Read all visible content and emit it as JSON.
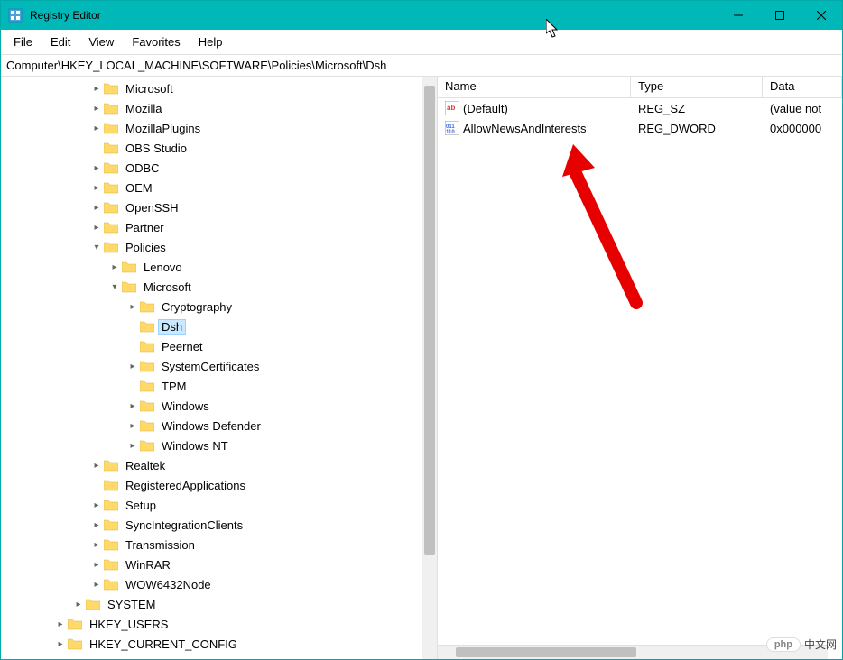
{
  "window": {
    "title": "Registry Editor"
  },
  "menu": {
    "items": [
      "File",
      "Edit",
      "View",
      "Favorites",
      "Help"
    ]
  },
  "address": "Computer\\HKEY_LOCAL_MACHINE\\SOFTWARE\\Policies\\Microsoft\\Dsh",
  "tree": [
    {
      "depth": 2,
      "chev": ">",
      "label": "Microsoft"
    },
    {
      "depth": 2,
      "chev": ">",
      "label": "Mozilla"
    },
    {
      "depth": 2,
      "chev": ">",
      "label": "MozillaPlugins"
    },
    {
      "depth": 2,
      "chev": "",
      "label": "OBS Studio"
    },
    {
      "depth": 2,
      "chev": ">",
      "label": "ODBC"
    },
    {
      "depth": 2,
      "chev": ">",
      "label": "OEM"
    },
    {
      "depth": 2,
      "chev": ">",
      "label": "OpenSSH"
    },
    {
      "depth": 2,
      "chev": ">",
      "label": "Partner"
    },
    {
      "depth": 2,
      "chev": "v",
      "label": "Policies"
    },
    {
      "depth": 3,
      "chev": ">",
      "label": "Lenovo"
    },
    {
      "depth": 3,
      "chev": "v",
      "label": "Microsoft"
    },
    {
      "depth": 4,
      "chev": ">",
      "label": "Cryptography"
    },
    {
      "depth": 4,
      "chev": "",
      "label": "Dsh",
      "selected": true
    },
    {
      "depth": 4,
      "chev": "",
      "label": "Peernet"
    },
    {
      "depth": 4,
      "chev": ">",
      "label": "SystemCertificates"
    },
    {
      "depth": 4,
      "chev": "",
      "label": "TPM"
    },
    {
      "depth": 4,
      "chev": ">",
      "label": "Windows"
    },
    {
      "depth": 4,
      "chev": ">",
      "label": "Windows Defender"
    },
    {
      "depth": 4,
      "chev": ">",
      "label": "Windows NT"
    },
    {
      "depth": 2,
      "chev": ">",
      "label": "Realtek"
    },
    {
      "depth": 2,
      "chev": "",
      "label": "RegisteredApplications"
    },
    {
      "depth": 2,
      "chev": ">",
      "label": "Setup"
    },
    {
      "depth": 2,
      "chev": ">",
      "label": "SyncIntegrationClients"
    },
    {
      "depth": 2,
      "chev": ">",
      "label": "Transmission"
    },
    {
      "depth": 2,
      "chev": ">",
      "label": "WinRAR"
    },
    {
      "depth": 2,
      "chev": ">",
      "label": "WOW6432Node"
    },
    {
      "depth": 1,
      "chev": ">",
      "label": "SYSTEM"
    },
    {
      "depth": 0,
      "chev": ">",
      "label": "HKEY_USERS"
    },
    {
      "depth": 0,
      "chev": ">",
      "label": "HKEY_CURRENT_CONFIG"
    }
  ],
  "columns": {
    "name": "Name",
    "type": "Type",
    "data": "Data"
  },
  "values": [
    {
      "icon": "sz",
      "name": "(Default)",
      "type": "REG_SZ",
      "data": "(value not"
    },
    {
      "icon": "dw",
      "name": "AllowNewsAndInterests",
      "type": "REG_DWORD",
      "data": "0x000000"
    }
  ],
  "watermark": {
    "label": "php",
    "text": "中文网"
  }
}
